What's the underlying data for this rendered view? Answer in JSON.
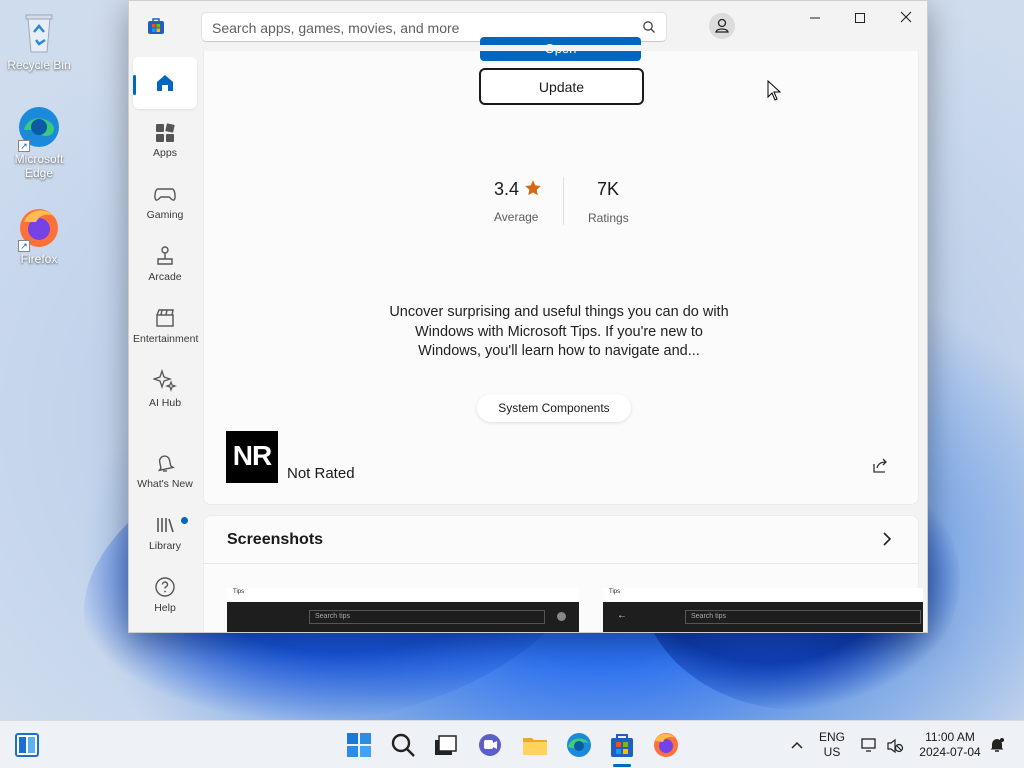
{
  "desktop": {
    "icons": [
      {
        "label": "Recycle Bin",
        "icon": "recycle-bin-icon"
      },
      {
        "label": "Microsoft Edge",
        "icon": "edge-icon"
      },
      {
        "label": "Firefox",
        "icon": "firefox-icon"
      }
    ]
  },
  "window": {
    "search": {
      "placeholder": "Search apps, games, movies, and more"
    },
    "nav": [
      {
        "label": "",
        "icon": "home-icon",
        "active": true
      },
      {
        "label": "Apps",
        "icon": "apps-icon"
      },
      {
        "label": "Gaming",
        "icon": "gamepad-icon"
      },
      {
        "label": "Arcade",
        "icon": "joystick-icon"
      },
      {
        "label": "Entertainment",
        "icon": "clapperboard-icon"
      },
      {
        "label": "AI Hub",
        "icon": "sparkle-icon"
      },
      {
        "label": "What's New",
        "icon": "bell-icon"
      },
      {
        "label": "Library",
        "icon": "library-icon"
      },
      {
        "label": "Help",
        "icon": "help-icon"
      }
    ],
    "app": {
      "open_label": "Open",
      "update_label": "Update",
      "rating_value": "3.4",
      "rating_label": "Average",
      "ratings_count": "7K",
      "ratings_label": "Ratings",
      "description": "Uncover surprising and useful things you can do with Windows with Microsoft Tips. If you're new to Windows, you'll learn how to navigate and...",
      "category": "System Components",
      "age_badge": "NR",
      "age_label": "Not Rated"
    },
    "screenshots": {
      "title": "Screenshots",
      "thumbs": [
        {
          "app_label": "Tips",
          "search_placeholder": "Search tips"
        },
        {
          "app_label": "Tips",
          "search_placeholder": "Search tips"
        }
      ]
    }
  },
  "taskbar": {
    "apps": [
      "start-icon",
      "search-icon",
      "task-view-icon",
      "chat-icon",
      "file-explorer-icon",
      "edge-icon",
      "store-icon",
      "firefox-icon"
    ],
    "lang_line1": "ENG",
    "lang_line2": "US",
    "time": "11:00 AM",
    "date": "2024-07-04"
  },
  "colors": {
    "accent": "#0067c0",
    "window_bg": "#f3f3f3"
  }
}
